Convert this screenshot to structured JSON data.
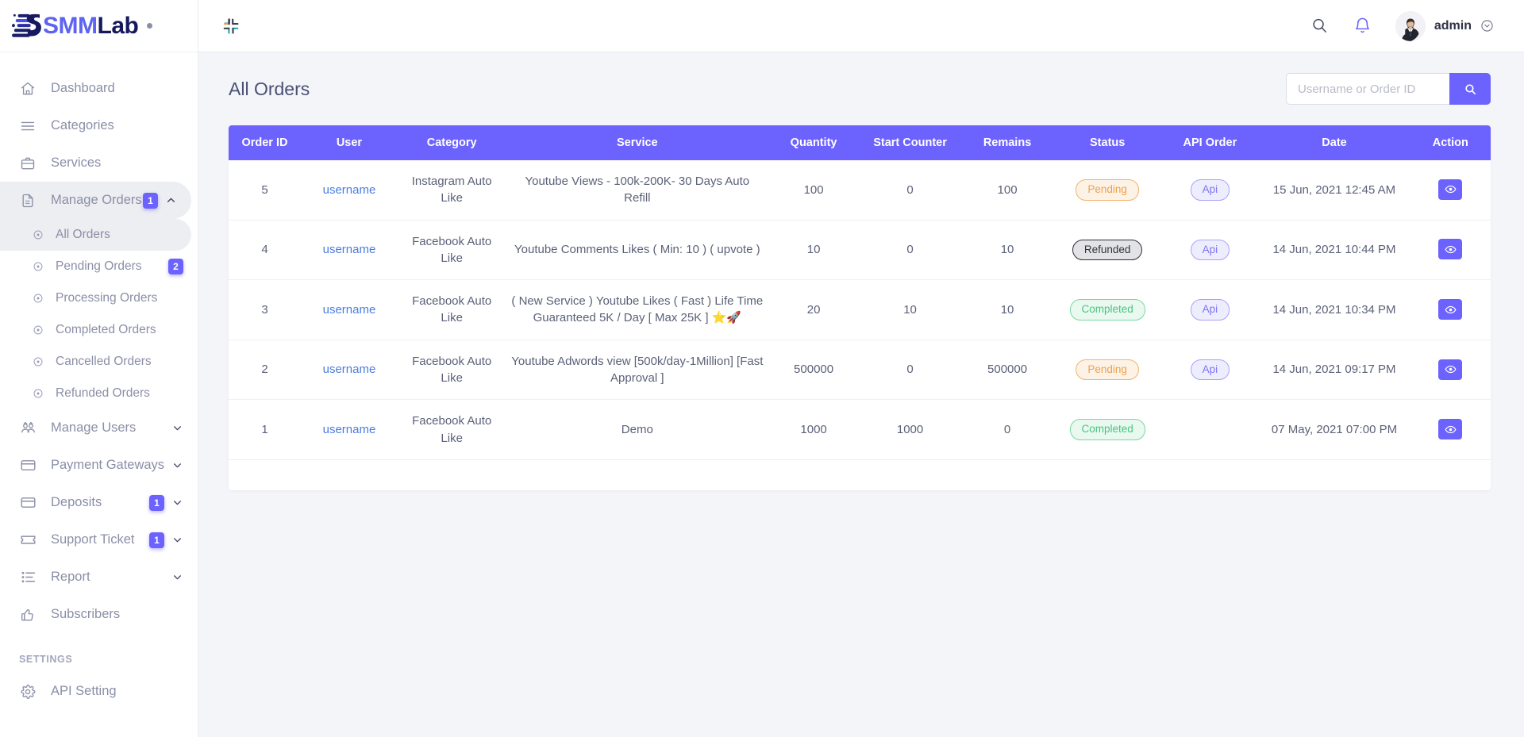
{
  "brand": {
    "smm": "SMM",
    "lab": "Lab"
  },
  "header": {
    "collapse_icon": "compress-icon",
    "search_icon": "search-icon",
    "bell_icon": "bell-icon",
    "username": "admin",
    "chevron_icon": "chevron-down-icon"
  },
  "sidebar": {
    "items": [
      {
        "label": "Dashboard",
        "icon": "home-icon",
        "badge": null,
        "chevron": null,
        "active": false
      },
      {
        "label": "Categories",
        "icon": "list-icon",
        "badge": null,
        "chevron": null,
        "active": false
      },
      {
        "label": "Services",
        "icon": "briefcase-icon",
        "badge": null,
        "chevron": null,
        "active": false
      },
      {
        "label": "Manage Orders",
        "icon": "file-icon",
        "badge": "1",
        "chevron": "chevron-up-icon",
        "active": true
      }
    ],
    "sub_items": [
      {
        "label": "All Orders",
        "badge": null,
        "active": true
      },
      {
        "label": "Pending Orders",
        "badge": "2",
        "active": false
      },
      {
        "label": "Processing Orders",
        "badge": null,
        "active": false
      },
      {
        "label": "Completed Orders",
        "badge": null,
        "active": false
      },
      {
        "label": "Cancelled Orders",
        "badge": null,
        "active": false
      },
      {
        "label": "Refunded Orders",
        "badge": null,
        "active": false
      }
    ],
    "items_after": [
      {
        "label": "Manage Users",
        "icon": "users-icon",
        "badge": null,
        "chevron": "chevron-down-icon"
      },
      {
        "label": "Payment Gateways",
        "icon": "card-icon",
        "badge": null,
        "chevron": "chevron-down-icon"
      },
      {
        "label": "Deposits",
        "icon": "card-icon",
        "badge": "1",
        "chevron": "chevron-down-icon"
      },
      {
        "label": "Support Ticket",
        "icon": "ticket-icon",
        "badge": "1",
        "chevron": "chevron-down-icon"
      },
      {
        "label": "Report",
        "icon": "report-icon",
        "badge": null,
        "chevron": "chevron-down-icon"
      },
      {
        "label": "Subscribers",
        "icon": "thumbs-up-icon",
        "badge": null,
        "chevron": null
      }
    ],
    "settings_header": "SETTINGS",
    "settings_items": [
      {
        "label": "API Setting",
        "icon": "gear-icon",
        "badge": null,
        "chevron": null
      }
    ]
  },
  "main": {
    "page_title": "All Orders",
    "search": {
      "placeholder": "Username or Order ID",
      "value": ""
    },
    "table": {
      "columns": [
        "Order ID",
        "User",
        "Category",
        "Service",
        "Quantity",
        "Start Counter",
        "Remains",
        "Status",
        "API Order",
        "Date",
        "Action"
      ],
      "rows": [
        {
          "order_id": "5",
          "user": "username",
          "category": "Instagram Auto Like",
          "service": "Youtube Views - 100k-200K- 30 Days Auto Refill",
          "quantity": "100",
          "start_counter": "0",
          "remains": "100",
          "status": "Pending",
          "status_type": "pending",
          "api_order": "Api",
          "date": "15 Jun, 2021 12:45 AM",
          "action": "view-icon"
        },
        {
          "order_id": "4",
          "user": "username",
          "category": "Facebook Auto Like",
          "service": "Youtube Comments Likes ( Min: 10 ) ( upvote )",
          "quantity": "10",
          "start_counter": "0",
          "remains": "10",
          "status": "Refunded",
          "status_type": "refunded",
          "api_order": "Api",
          "date": "14 Jun, 2021 10:44 PM",
          "action": "view-icon"
        },
        {
          "order_id": "3",
          "user": "username",
          "category": "Facebook Auto Like",
          "service": "( New Service ) Youtube Likes ( Fast ) Life Time Guaranteed 5K / Day [ Max 25K ] ⭐🚀",
          "quantity": "20",
          "start_counter": "10",
          "remains": "10",
          "status": "Completed",
          "status_type": "completed",
          "api_order": "Api",
          "date": "14 Jun, 2021 10:34 PM",
          "action": "view-icon"
        },
        {
          "order_id": "2",
          "user": "username",
          "category": "Facebook Auto Like",
          "service": "Youtube Adwords view [500k/day-1Million] [Fast Approval ]",
          "quantity": "500000",
          "start_counter": "0",
          "remains": "500000",
          "status": "Pending",
          "status_type": "pending",
          "api_order": "Api",
          "date": "14 Jun, 2021 09:17 PM",
          "action": "view-icon"
        },
        {
          "order_id": "1",
          "user": "username",
          "category": "Facebook Auto Like",
          "service": "Demo",
          "quantity": "1000",
          "start_counter": "1000",
          "remains": "0",
          "status": "Completed",
          "status_type": "completed",
          "api_order": "",
          "date": "07 May, 2021 07:00 PM",
          "action": "view-icon"
        }
      ]
    }
  },
  "colors": {
    "accent": "#6c63ff",
    "pending": "#f0a04b",
    "completed": "#4ac47f",
    "refunded": "#30343f",
    "link": "#4a7de0"
  }
}
